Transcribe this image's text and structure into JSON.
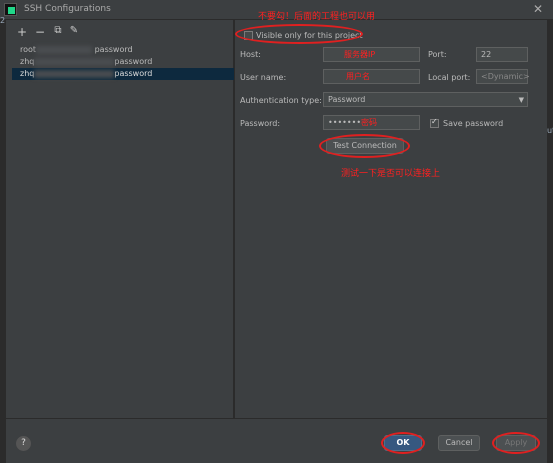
{
  "window": {
    "title": "SSH Configurations",
    "close_glyph": "✕"
  },
  "toolbar": {
    "add": "+",
    "remove": "−",
    "copy": "⧉",
    "edit": "✎"
  },
  "configs": [
    {
      "prefix": "root",
      "suffix": "password"
    },
    {
      "prefix": "zhq",
      "suffix": "password"
    },
    {
      "prefix": "zhq",
      "suffix": "password"
    }
  ],
  "form": {
    "visible_only_label": "Visible only for this project",
    "host_label": "Host:",
    "host_value": "服务器IP",
    "port_label": "Port:",
    "port_value": "22",
    "user_label": "User name:",
    "user_value": "用户名",
    "local_port_label": "Local port:",
    "local_port_placeholder": "<Dynamic>",
    "auth_label": "Authentication type:",
    "auth_value": "Password",
    "password_label": "Password:",
    "password_dots": "•••••••",
    "password_note": "密码",
    "save_password_label": "Save password",
    "test_button": "Test Connection"
  },
  "annotations": {
    "top": "不要勾！后面的工程也可以用",
    "test": "测试一下是否可以连接上"
  },
  "footer": {
    "help": "?",
    "ok": "OK",
    "cancel": "Cancel",
    "apply": "Apply"
  },
  "edge": {
    "left_top": "2.",
    "right_mid": "ut"
  },
  "colors": {
    "annotation": "#ff2020",
    "selection": "#0d293e",
    "primary": "#365880"
  }
}
